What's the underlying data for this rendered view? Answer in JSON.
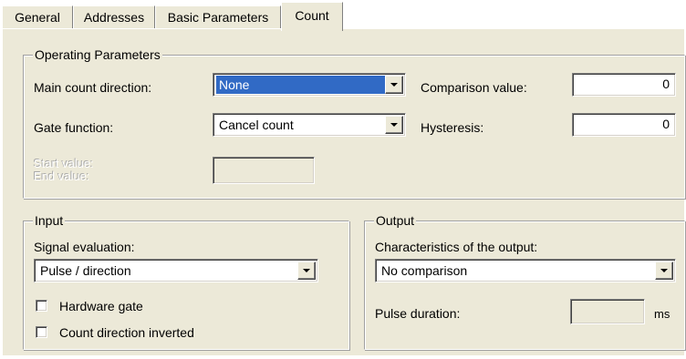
{
  "tabs": [
    {
      "label": "General"
    },
    {
      "label": "Addresses"
    },
    {
      "label": "Basic Parameters"
    },
    {
      "label": "Count",
      "active": true
    }
  ],
  "operating": {
    "title": "Operating Parameters",
    "main_count_direction": {
      "label": "Main count direction:",
      "value": "None"
    },
    "gate_function": {
      "label": "Gate function:",
      "value": "Cancel count"
    },
    "comparison_value": {
      "label": "Comparison value:",
      "value": "0"
    },
    "hysteresis": {
      "label": "Hysteresis:",
      "value": "0"
    },
    "start_value_label": "Start value:",
    "end_value_label": "End value:",
    "start_end_value": ""
  },
  "input": {
    "title": "Input",
    "signal_evaluation": {
      "label": "Signal evaluation:",
      "value": "Pulse / direction"
    },
    "hardware_gate": {
      "label": "Hardware gate",
      "checked": false
    },
    "count_direction_inverted": {
      "label": "Count direction inverted",
      "checked": false
    }
  },
  "output": {
    "title": "Output",
    "characteristics": {
      "label": "Characteristics of the output:",
      "value": "No comparison"
    },
    "pulse_duration": {
      "label": "Pulse duration:",
      "value": "",
      "unit": "ms"
    }
  },
  "colors": {
    "face": "#ece9d8",
    "selection": "#316ac5"
  }
}
